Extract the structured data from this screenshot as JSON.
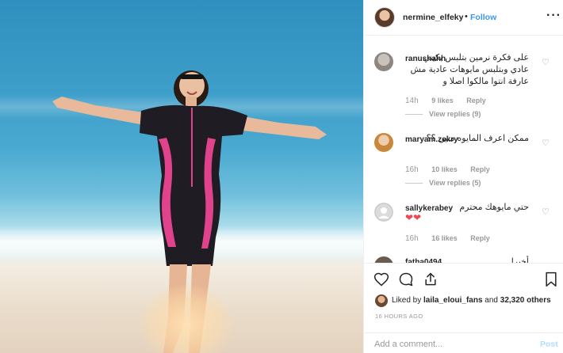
{
  "post": {
    "author": "nermine_elfeky",
    "separator": "•",
    "follow_label": "Follow",
    "more_icon": "more-options-icon"
  },
  "comments": [
    {
      "user": "ranushahh",
      "text": "على فكرة نرمين بتلبس بكيني عادي وبتلبس مايوهات عادية مش عارفة انتوا مالكوا اصلا و",
      "time": "14h",
      "likes": "9 likes",
      "reply": "Reply",
      "replies": "View replies (9)"
    },
    {
      "user": "maryam.zekry",
      "text": "ممكن اعرف المايوه منين ؟؟",
      "time": "16h",
      "likes": "10 likes",
      "reply": "Reply",
      "replies": "View replies (5)"
    },
    {
      "user": "sallykerabey",
      "text": "حتي مايوهك محترم",
      "hearts": "❤❤",
      "time": "16h",
      "likes": "16 likes",
      "reply": "Reply"
    },
    {
      "user": "fatha0494",
      "text": "أخيرا"
    }
  ],
  "likes_line": {
    "prefix": "Liked by",
    "user": "laila_eloui_fans",
    "middle": "and",
    "others": "32,320 others"
  },
  "timestamp": "16 HOURS AGO",
  "add_comment": {
    "placeholder": "Add a comment...",
    "post_label": "Post"
  },
  "colors": {
    "link": "#3897f0",
    "post_disabled": "#b2dffc",
    "heart": "#ed4956"
  }
}
